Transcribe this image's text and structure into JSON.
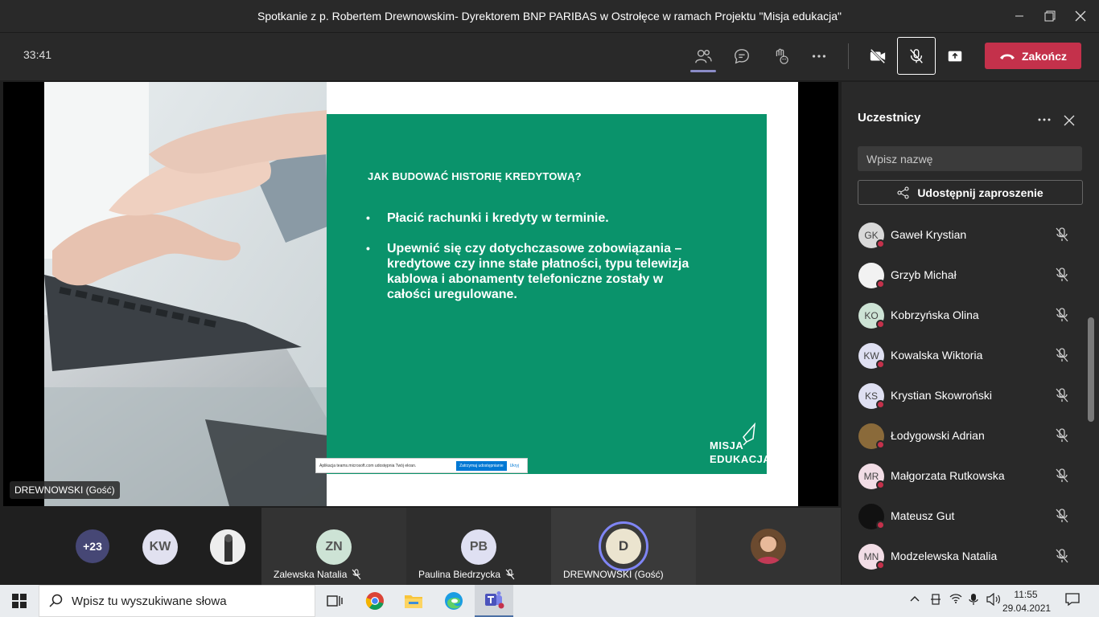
{
  "window": {
    "title": "Spotkanie z p. Robertem Drewnowskim- Dyrektorem BNP PARIBAS w Ostrołęce w ramach Projektu \"Misja edukacja\""
  },
  "toolbar": {
    "timer": "33:41",
    "end_label": "Zakończ",
    "accent": "#c4314b"
  },
  "slide": {
    "heading": "JAK BUDOWAĆ HISTORIĘ KREDYTOWĄ?",
    "bullet_symbol": "•",
    "bullets": [
      "Płacić rachunki i kredyty w terminie.",
      "Upewnić się czy dotychczasowe zobowiązania – kredytowe czy inne stałe płatności, typu telewizja kablowa i abonamenty telefoniczne zostały w całości uregulowane."
    ],
    "logo_line1": "MISJA",
    "logo_line2": "EDUKACJA",
    "background": "#0a936b"
  },
  "share_bar": {
    "message": "Aplikacja teams.microsoft.com udostępnia Twój ekran.",
    "stop_label": "Zatrzymaj udostępnianie",
    "hide_label": "Ukryj"
  },
  "presenter_label": "DREWNOWSKI (Gość)",
  "gallery": {
    "more_count": "+23",
    "tiles": [
      {
        "initials": "KW"
      },
      {
        "initials": "ZN",
        "name": "Zalewska Natalia"
      },
      {
        "initials": "PB",
        "name": "Paulina Biedrzycka"
      },
      {
        "initials": "D",
        "name": "DREWNOWSKI (Gość)"
      }
    ]
  },
  "panel": {
    "title": "Uczestnicy",
    "search_placeholder": "Wpisz nazwę",
    "invite_label": "Udostępnij zaproszenie",
    "participants": [
      {
        "initials": "GK",
        "name": "Gaweł Krystian",
        "color": "#d9d9d9"
      },
      {
        "initials": "",
        "name": "Grzyb Michał",
        "color": "#f2f2f2"
      },
      {
        "initials": "KO",
        "name": "Kobrzyńska Olina",
        "color": "#cde3d5"
      },
      {
        "initials": "KW",
        "name": "Kowalska Wiktoria",
        "color": "#dfe0f2"
      },
      {
        "initials": "KS",
        "name": "Krystian Skowroński",
        "color": "#dfe0f2"
      },
      {
        "initials": "",
        "name": "Łodygowski Adrian",
        "color": "#8a6a3a"
      },
      {
        "initials": "MR",
        "name": "Małgorzata Rutkowska",
        "color": "#f2dde6"
      },
      {
        "initials": "",
        "name": "Mateusz Gut",
        "color": "#111111"
      },
      {
        "initials": "MN",
        "name": "Modzelewska Natalia",
        "color": "#f2dde6"
      }
    ]
  },
  "taskbar": {
    "search_placeholder": "Wpisz tu wyszukiwane słowa",
    "time": "11:55",
    "date": "29.04.2021"
  }
}
